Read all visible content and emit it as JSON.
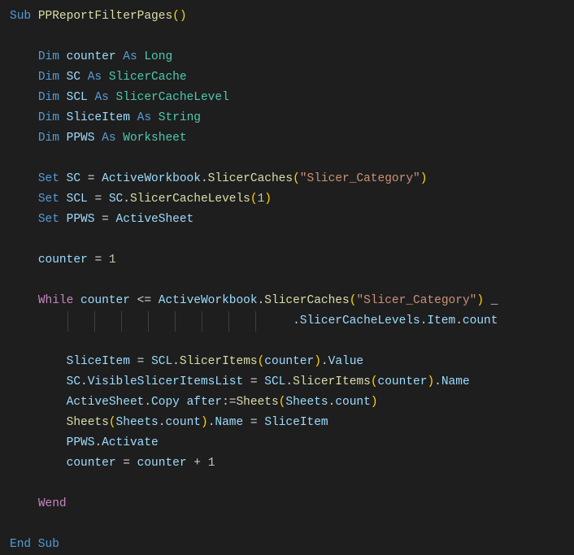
{
  "code": {
    "sub_kw": "Sub",
    "sub_name": "PPReportFilterPages",
    "dim_kw": "Dim",
    "as_kw": "As",
    "set_kw": "Set",
    "while_kw": "While",
    "wend_kw": "Wend",
    "end_sub": "End Sub",
    "vars": {
      "counter": "counter",
      "SC": "SC",
      "SCL": "SCL",
      "SliceItem": "SliceItem",
      "PPWS": "PPWS",
      "ActiveWorkbook": "ActiveWorkbook",
      "ActiveSheet": "ActiveSheet",
      "Sheets": "Sheets"
    },
    "types": {
      "Long": "Long",
      "SlicerCache": "SlicerCache",
      "SlicerCacheLevel": "SlicerCacheLevel",
      "String": "String",
      "Worksheet": "Worksheet"
    },
    "funcs": {
      "SlicerCaches": "SlicerCaches",
      "SlicerCacheLevels": "SlicerCacheLevels",
      "SlicerItems": "SlicerItems"
    },
    "members": {
      "VisibleSlicerItemsList": "VisibleSlicerItemsList",
      "Value": "Value",
      "Name": "Name",
      "count": "count",
      "Item": "Item",
      "Copy": "Copy",
      "Activate": "Activate",
      "after": "after"
    },
    "strings": {
      "slicer_cat": "\"Slicer_Category\""
    },
    "nums": {
      "one": "1"
    },
    "ops": {
      "eq": "=",
      "lte": "<=",
      "plus": "+",
      "assign": ":=",
      "cont": "_",
      "dot": "."
    }
  }
}
